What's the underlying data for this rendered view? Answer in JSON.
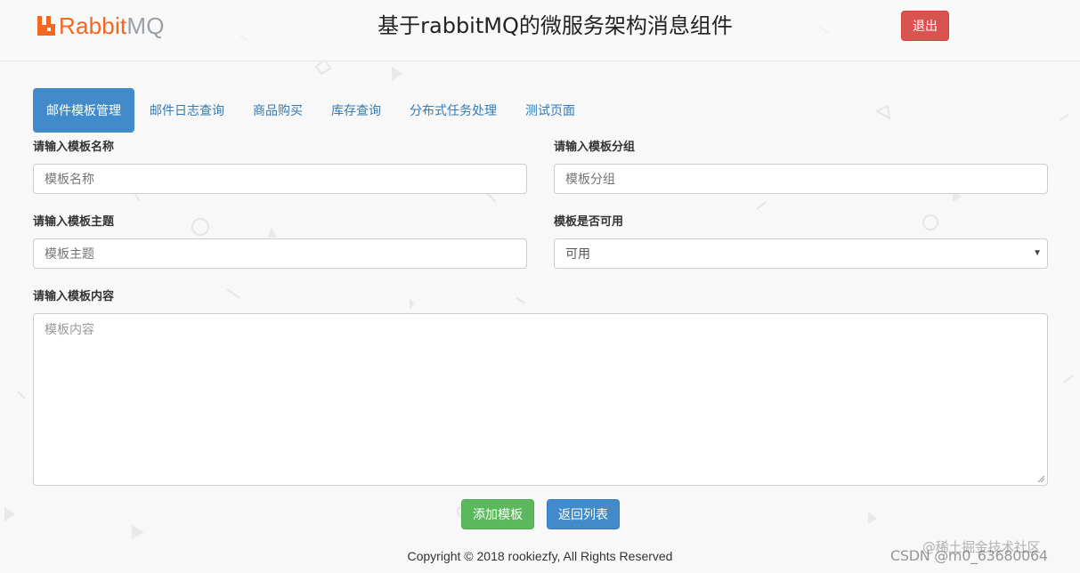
{
  "header": {
    "logo_word_1": "Rabbit",
    "logo_word_2": "MQ",
    "title": "基于rabbitMQ的微服务架构消息组件",
    "logout_label": "退出"
  },
  "tabs": [
    {
      "label": "邮件模板管理",
      "active": true
    },
    {
      "label": "邮件日志查询",
      "active": false
    },
    {
      "label": "商品购买",
      "active": false
    },
    {
      "label": "库存查询",
      "active": false
    },
    {
      "label": "分布式任务处理",
      "active": false
    },
    {
      "label": "测试页面",
      "active": false
    }
  ],
  "form": {
    "name": {
      "label": "请输入模板名称",
      "placeholder": "模板名称",
      "value": ""
    },
    "group": {
      "label": "请输入模板分组",
      "placeholder": "模板分组",
      "value": ""
    },
    "subject": {
      "label": "请输入模板主题",
      "placeholder": "模板主题",
      "value": ""
    },
    "enabled": {
      "label": "模板是否可用",
      "selected": "可用"
    },
    "content": {
      "label": "请输入模板内容",
      "placeholder": "模板内容",
      "value": ""
    }
  },
  "actions": {
    "add_label": "添加模板",
    "back_label": "返回列表"
  },
  "footer": {
    "copyright": "Copyright © 2018 rookiezfy, All Rights Reserved"
  },
  "watermark": {
    "line1": "@稀土掘金技术社区",
    "line2": "CSDN @m0_63680064"
  },
  "colors": {
    "brand_orange": "#f26822",
    "primary": "#428bca",
    "success": "#5cb85c",
    "danger": "#d9534f",
    "link": "#337ab7"
  }
}
